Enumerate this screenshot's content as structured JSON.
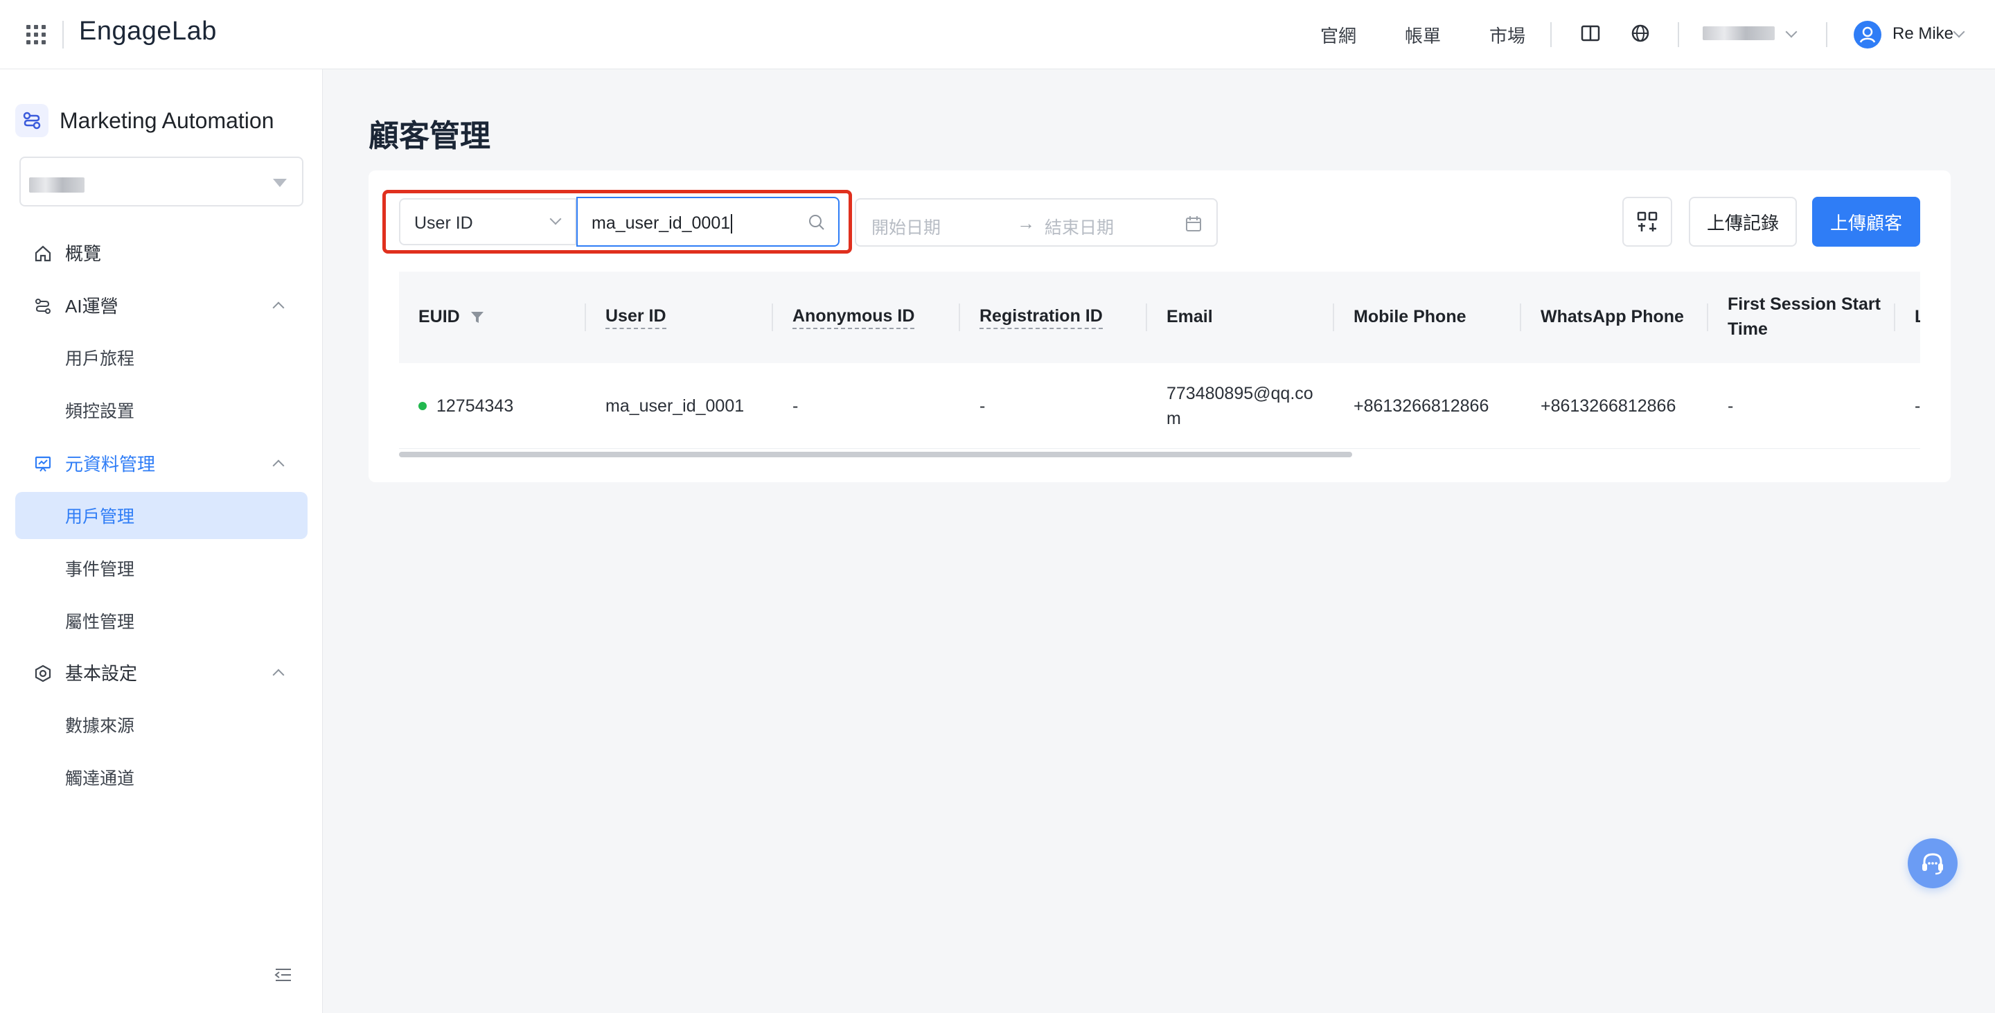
{
  "topbar": {
    "logo_text": "EngageLab",
    "nav": [
      "官網",
      "帳單",
      "市場"
    ],
    "user_name": "Re Mike"
  },
  "sidebar": {
    "product_name": "Marketing Automation",
    "menu": {
      "overview": "概覽",
      "ai_ops": "AI運營",
      "user_journey": "用戶旅程",
      "frequency": "頻控設置",
      "metadata": "元資料管理",
      "user_mgmt": "用戶管理",
      "event_mgmt": "事件管理",
      "attr_mgmt": "屬性管理",
      "basic_settings": "基本設定",
      "data_source": "數據來源",
      "channels": "觸達通道"
    }
  },
  "main": {
    "page_title": "顧客管理",
    "filter": {
      "field": "User ID",
      "search_value": "ma_user_id_0001",
      "start_date_placeholder": "開始日期",
      "arrow": "→",
      "end_date_placeholder": "結束日期"
    },
    "buttons": {
      "records": "上傳記錄",
      "upload": "上傳顧客"
    },
    "table": {
      "columns": [
        "EUID",
        "User ID",
        "Anonymous ID",
        "Registration ID",
        "Email",
        "Mobile Phone",
        "WhatsApp Phone",
        "First Session Start Time",
        "L"
      ],
      "rows": [
        {
          "euid": "12754343",
          "user_id": "ma_user_id_0001",
          "anonymous_id": "-",
          "registration_id": "-",
          "email": "773480895@qq.com",
          "mobile_phone": "+8613266812866",
          "whatsapp_phone": "+8613266812866",
          "first_session": "-",
          "last": "-"
        }
      ]
    }
  },
  "colors": {
    "primary": "#2f7df6",
    "highlight_border": "#e0301e",
    "status_dot": "#22b84f"
  }
}
